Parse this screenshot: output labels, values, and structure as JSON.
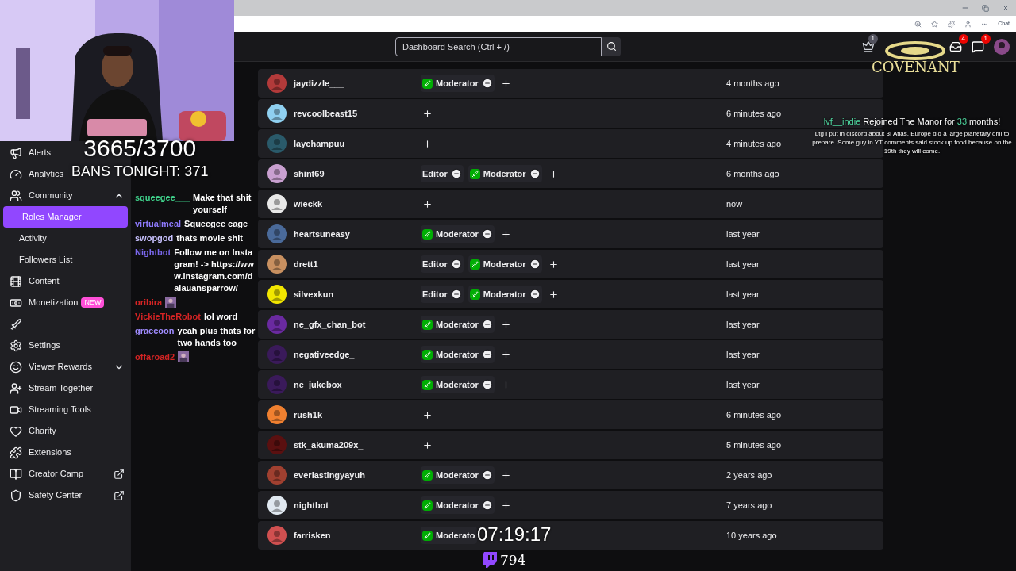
{
  "browser": {
    "toolbar_label": "Chat"
  },
  "header": {
    "search": {
      "placeholder": "Dashboard Search (Ctrl + /)"
    },
    "crown_badge": "1",
    "inbox_badge": "4",
    "whispers_badge": "1"
  },
  "sidebar": {
    "items": [
      {
        "label": "Alerts",
        "kind": "item",
        "selected": false
      },
      {
        "label": "Analytics",
        "kind": "item",
        "selected": false
      },
      {
        "label": "Community",
        "kind": "group",
        "expanded": true,
        "selected": false
      },
      {
        "label": "Roles Manager",
        "kind": "sub",
        "selected": true
      },
      {
        "label": "Activity",
        "kind": "sub",
        "selected": false
      },
      {
        "label": "Followers List",
        "kind": "sub",
        "selected": false
      },
      {
        "label": "Content",
        "kind": "item",
        "selected": false
      },
      {
        "label": "Monetization",
        "kind": "item",
        "badge": "NEW",
        "selected": false
      },
      {
        "kind": "covered",
        "selected": false
      },
      {
        "label": "Settings",
        "kind": "item",
        "selected": false
      },
      {
        "label": "Viewer Rewards",
        "kind": "group",
        "expanded": false,
        "selected": false
      },
      {
        "label": "Stream Together",
        "kind": "item",
        "selected": false
      },
      {
        "label": "Streaming Tools",
        "kind": "item",
        "selected": false
      },
      {
        "label": "Charity",
        "kind": "item",
        "selected": false
      },
      {
        "label": "Extensions",
        "kind": "item",
        "selected": false
      },
      {
        "label": "Creator Camp",
        "kind": "link",
        "selected": false
      },
      {
        "label": "Safety Center",
        "kind": "link",
        "selected": false
      }
    ]
  },
  "roles_table": {
    "rows": [
      {
        "name": "jaydizzle___",
        "roles": [
          {
            "label": "Moderator",
            "kind": "moderator"
          }
        ],
        "added": "4 months ago",
        "covered": false
      },
      {
        "name": "revcoolbeast15",
        "roles": [],
        "added": "6 minutes ago",
        "covered": false
      },
      {
        "name": "laychampuu",
        "roles": [],
        "added": "4 minutes ago",
        "covered": false
      },
      {
        "name": "shint69",
        "roles": [
          {
            "label": "Editor",
            "kind": "editor"
          },
          {
            "label": "Moderator",
            "kind": "moderator"
          }
        ],
        "added": "6 months ago",
        "covered": false
      },
      {
        "name": "wieckk",
        "roles": [],
        "added": "now",
        "covered": false
      },
      {
        "name": "heartsuneasy",
        "roles": [
          {
            "label": "Moderator",
            "kind": "moderator"
          }
        ],
        "added": "last year",
        "covered": false
      },
      {
        "name": "drett1",
        "roles": [
          {
            "label": "Editor",
            "kind": "editor"
          },
          {
            "label": "Moderator",
            "kind": "moderator"
          }
        ],
        "added": "last year",
        "covered": false
      },
      {
        "name": "silvexkun",
        "roles": [
          {
            "label": "Editor",
            "kind": "editor"
          },
          {
            "label": "Moderator",
            "kind": "moderator"
          }
        ],
        "added": "last year",
        "covered": false
      },
      {
        "name": "ne_gfx_chan_bot",
        "roles": [
          {
            "label": "Moderator",
            "kind": "moderator"
          }
        ],
        "added": "last year",
        "covered": false
      },
      {
        "name": "negativeedge_",
        "roles": [
          {
            "label": "Moderator",
            "kind": "moderator"
          }
        ],
        "added": "last year",
        "covered": false
      },
      {
        "name": "ne_jukebox",
        "roles": [
          {
            "label": "Moderator",
            "kind": "moderator"
          }
        ],
        "added": "last year",
        "covered": false
      },
      {
        "name": "rush1k",
        "roles": [],
        "added": "6 minutes ago",
        "covered": false
      },
      {
        "name": "stk_akuma209x_",
        "roles": [],
        "added": "5 minutes ago",
        "covered": false
      },
      {
        "name": "everlastingyayuh",
        "roles": [
          {
            "label": "Moderator",
            "kind": "moderator"
          }
        ],
        "added": "2 years ago",
        "covered": false
      },
      {
        "name": "nightbot",
        "roles": [
          {
            "label": "Moderator",
            "kind": "moderator"
          }
        ],
        "added": "7 years ago",
        "covered": false
      },
      {
        "name": "farrisken",
        "roles": [
          {
            "label": "Moderato",
            "kind": "moderator"
          }
        ],
        "added": "10 years ago",
        "covered": true
      }
    ]
  },
  "stream_overlay": {
    "counter": "3665/3700",
    "bans": "BANS TONIGHT: 371",
    "timer": "07:19:17",
    "viewers": "794",
    "logo": "COVENANT",
    "alert": {
      "user": "lvf__indie",
      "text_before": "Rejoined The Manor for",
      "months": "33",
      "text_after": "months!",
      "message": "Ltg I put in discord about 3I Atlas. Europe did a large planetary drill to prepare. Some guy in YT comments said stock up food because on the 19th they will come."
    },
    "chat": [
      {
        "user": "squeegee___",
        "color": "#3fd08a",
        "kind": "text",
        "text": "Make that shit yourself"
      },
      {
        "user": "virtualmeal",
        "color": "#8f7bff",
        "kind": "text",
        "text": "Squeegee cage"
      },
      {
        "user": "swopgod",
        "color": "#c9c2ff",
        "kind": "text",
        "text": "thats movie shit"
      },
      {
        "user": "Nightbot",
        "color": "#7b68ee",
        "kind": "text",
        "text": "Follow me on Instagram! -> https://www.instagram.com/dalauansparrow/"
      },
      {
        "user": "oribira",
        "color": "#d42424",
        "kind": "emote"
      },
      {
        "user": "VickieTheRobot",
        "color": "#d42424",
        "kind": "text",
        "text": "lol word"
      },
      {
        "user": "graccoon",
        "color": "#a08cff",
        "kind": "text",
        "text": "yeah plus thats for two hands too"
      },
      {
        "user": "offaroad2",
        "color": "#d42424",
        "kind": "emote"
      }
    ]
  }
}
